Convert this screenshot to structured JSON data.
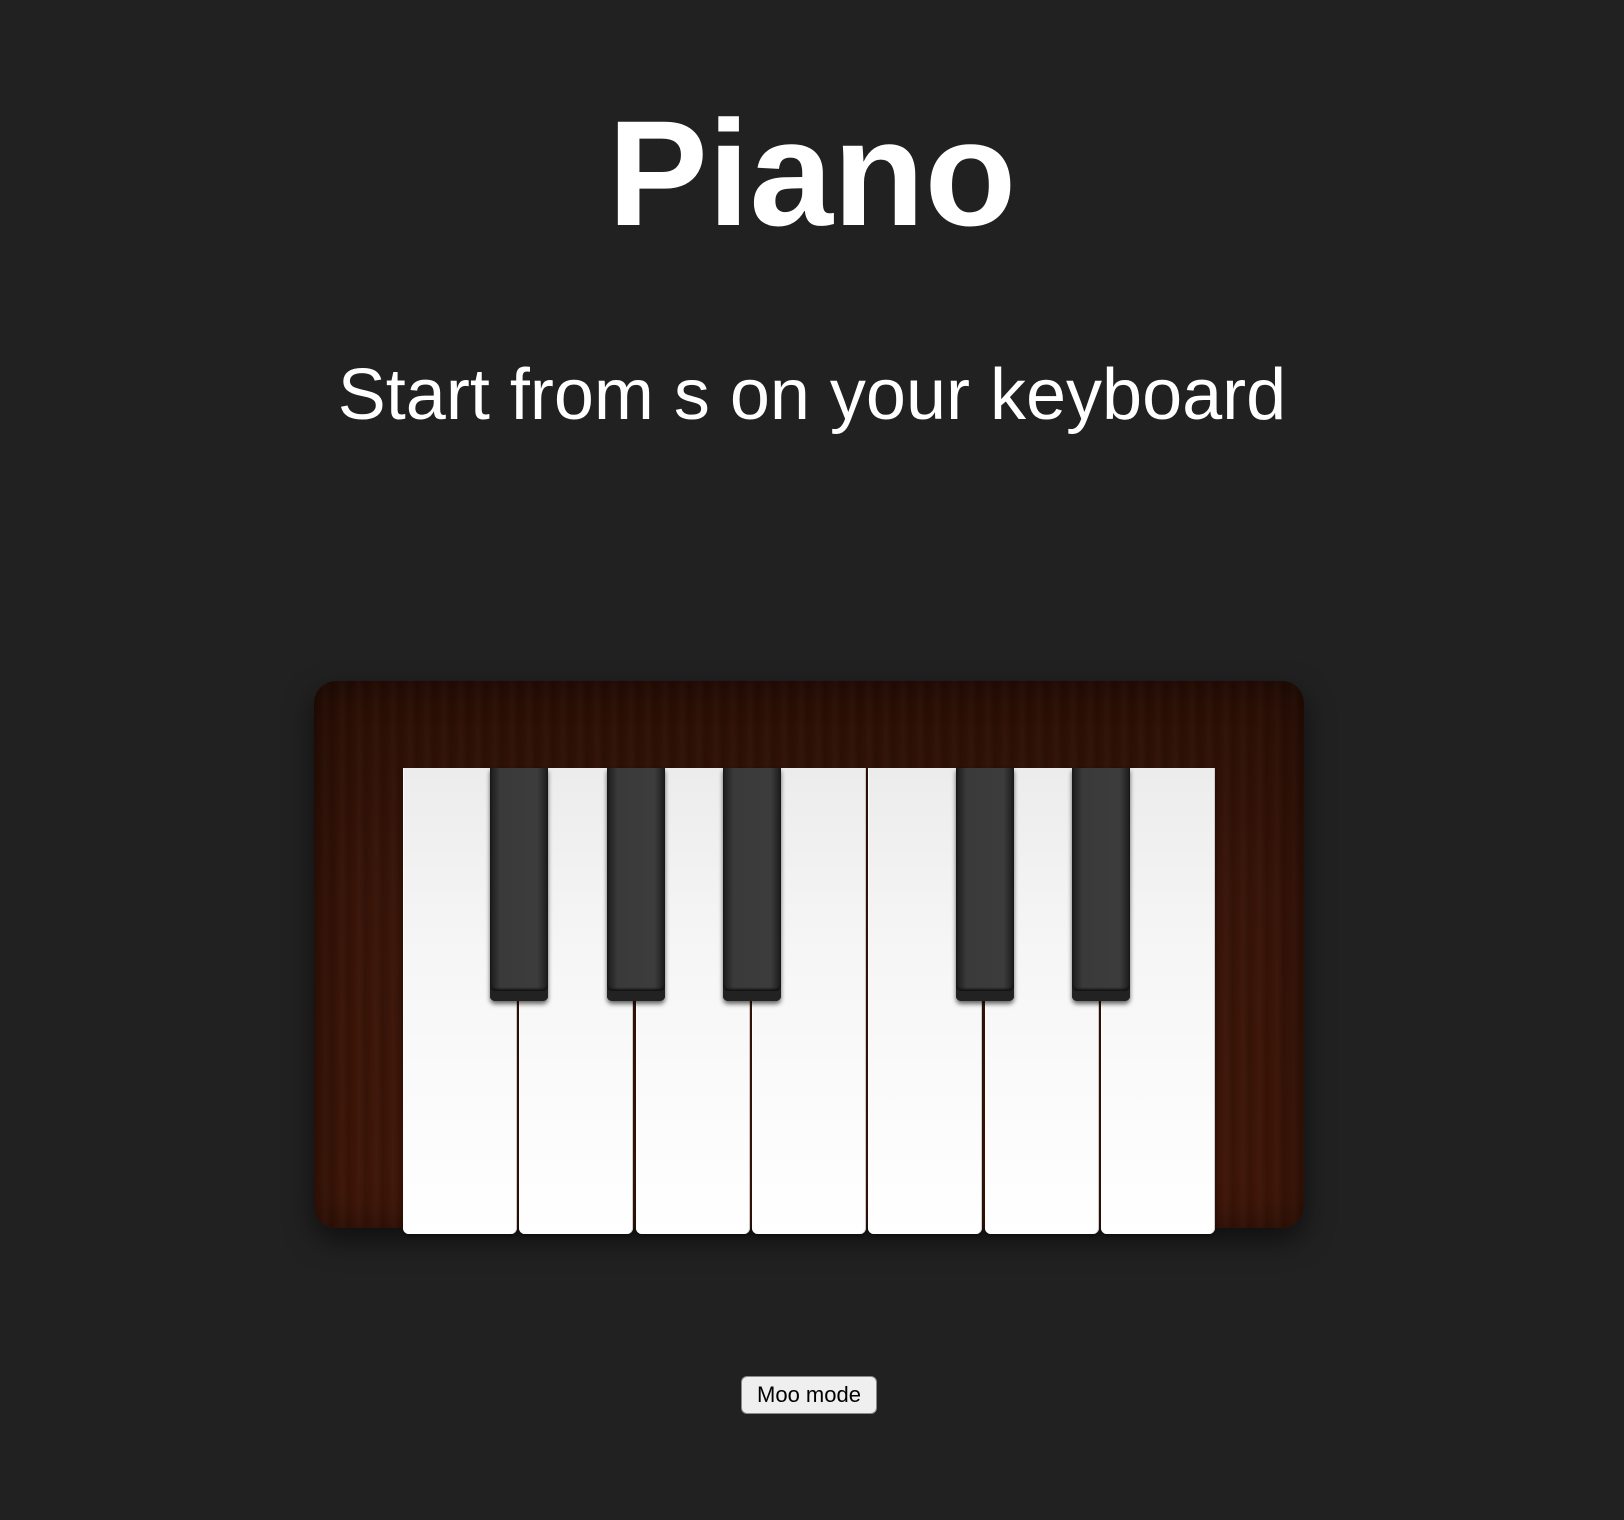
{
  "header": {
    "title": "Piano",
    "subtitle": "Start from s on your keyboard"
  },
  "piano": {
    "white_keys": 7,
    "black_keys_after_white": [
      0,
      1,
      2,
      4,
      5
    ]
  },
  "controls": {
    "moo_label": "Moo mode"
  },
  "colors": {
    "background": "#212121",
    "wood": "#381408",
    "white_key": "#f6f6f6",
    "black_key": "#2e2e2e"
  }
}
